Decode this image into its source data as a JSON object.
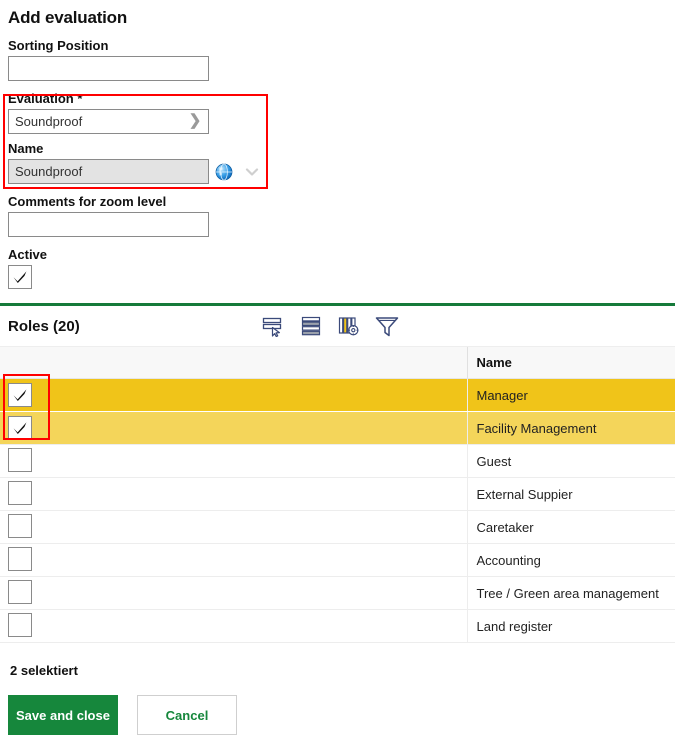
{
  "page": {
    "title": "Add evaluation"
  },
  "form": {
    "sorting_position": {
      "label": "Sorting Position",
      "value": "",
      "placeholder": ""
    },
    "evaluation": {
      "label": "Evaluation *",
      "value": "Soundproof",
      "placeholder": "",
      "lookup_icon": "chevron-right-icon"
    },
    "name": {
      "label": "Name",
      "value": "Soundproof",
      "placeholder": "",
      "globe_icon": "globe-icon",
      "dropdown_icon": "chevron-down-icon"
    },
    "comments": {
      "label": "Comments for zoom level",
      "value": "",
      "placeholder": ""
    },
    "active": {
      "label": "Active",
      "checked": true
    }
  },
  "roles": {
    "title": "Roles (20)",
    "count": 20,
    "toolbar": [
      {
        "name": "select-rows-icon",
        "label": "Select rows"
      },
      {
        "name": "list-view-icon",
        "label": "List view"
      },
      {
        "name": "column-settings-icon",
        "label": "Column settings"
      },
      {
        "name": "filter-icon",
        "label": "Filter"
      }
    ],
    "columns": [
      {
        "key": "check",
        "label": ""
      },
      {
        "key": "name",
        "label": "Name"
      }
    ],
    "rows": [
      {
        "name": "Manager",
        "checked": true,
        "highlight": "primary"
      },
      {
        "name": "Facility Management",
        "checked": true,
        "highlight": "secondary"
      },
      {
        "name": "Guest",
        "checked": false,
        "highlight": "none"
      },
      {
        "name": "External Suppier",
        "checked": false,
        "highlight": "none"
      },
      {
        "name": "Caretaker",
        "checked": false,
        "highlight": "none"
      },
      {
        "name": "Accounting",
        "checked": false,
        "highlight": "none"
      },
      {
        "name": "Tree / Green area management",
        "checked": false,
        "highlight": "none"
      },
      {
        "name": "Land register",
        "checked": false,
        "highlight": "none"
      }
    ]
  },
  "footer": {
    "selection_text": "2 selektiert",
    "save_label": "Save and close",
    "cancel_label": "Cancel"
  },
  "colors": {
    "green_divider": "#157a3a",
    "save_green": "#16873c",
    "row_highlight_primary": "#f0c419",
    "row_highlight_secondary": "#f4d55a",
    "annotation_red": "#ff0000"
  }
}
